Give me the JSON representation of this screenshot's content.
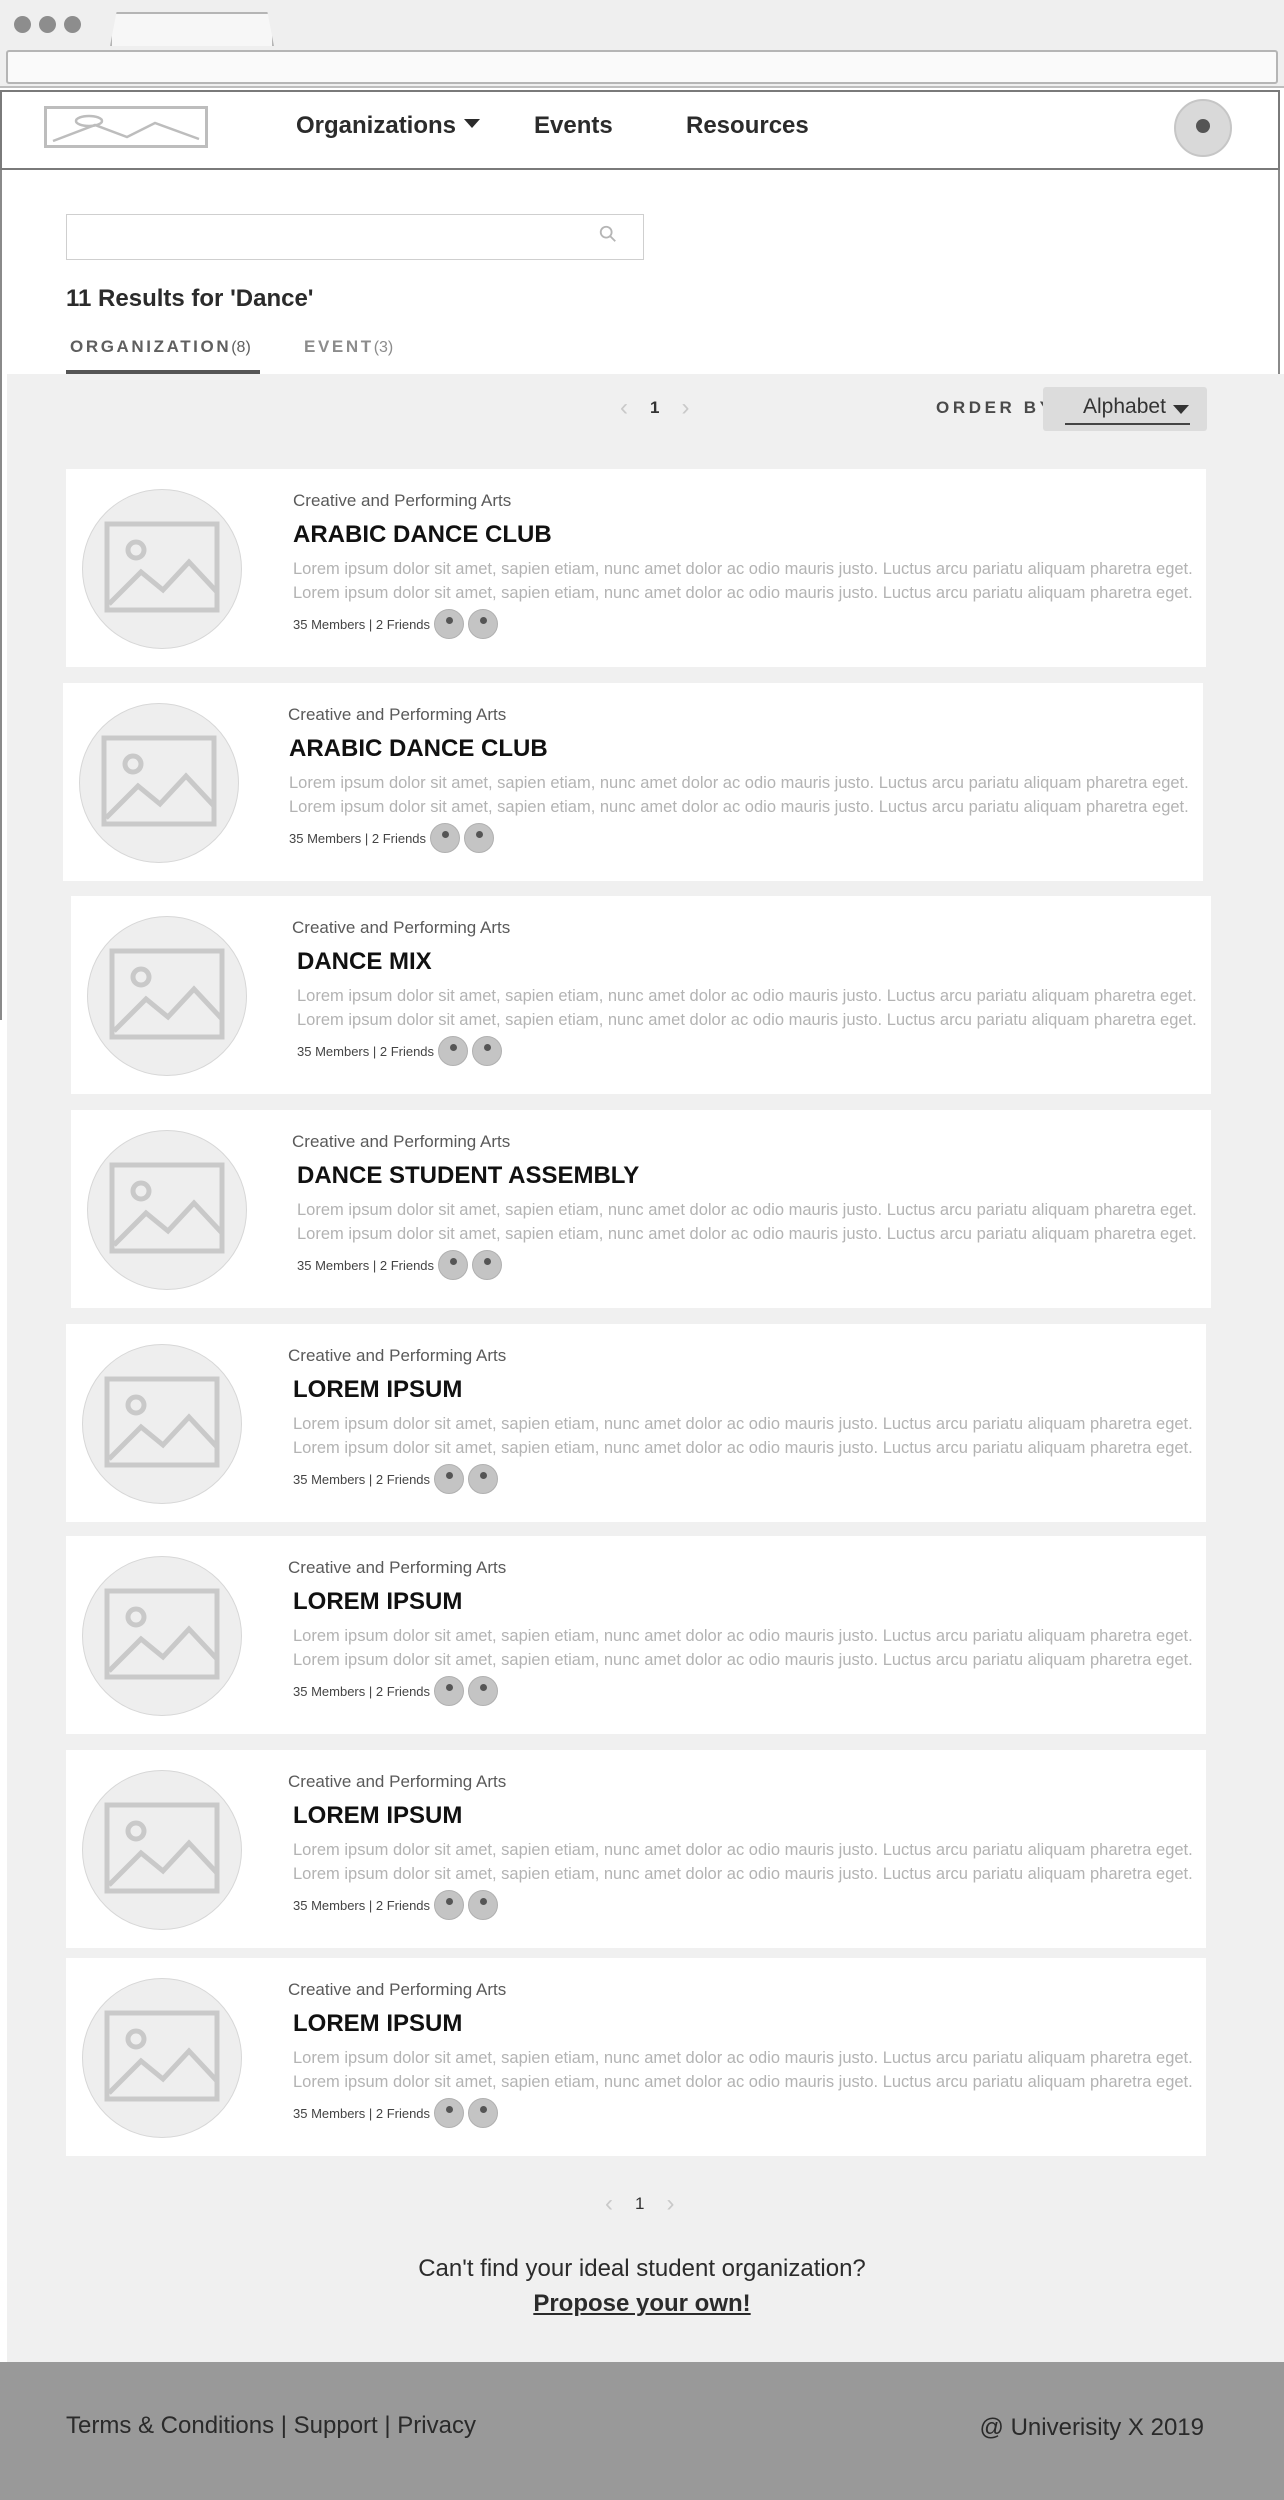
{
  "nav": {
    "organizations": "Organizations",
    "events": "Events",
    "resources": "Resources"
  },
  "search": {
    "value": "",
    "results_title": "11 Results for 'Dance'"
  },
  "tabs": [
    {
      "label": "ORGANIZATION",
      "count": "(8)"
    },
    {
      "label": "EVENT",
      "count": "(3)"
    }
  ],
  "pager": {
    "page": "1",
    "prev": "‹",
    "next": "›"
  },
  "order": {
    "label": "ORDER BY",
    "value": "Alphabet"
  },
  "cards": [
    {
      "category": "Creative and Performing Arts",
      "title": "ARABIC DANCE CLUB",
      "desc1": "Lorem ipsum dolor sit amet, sapien etiam, nunc amet dolor ac odio mauris justo. Luctus arcu pariatu aliquam pharetra eget.",
      "desc2": "Lorem ipsum dolor sit amet, sapien etiam, nunc amet dolor ac odio mauris justo. Luctus arcu pariatu aliquam pharetra eget.",
      "meta": "35 Members | 2 Friends"
    },
    {
      "category": "Creative and Performing Arts",
      "title": "ARABIC DANCE CLUB",
      "desc1": "Lorem ipsum dolor sit amet, sapien etiam, nunc amet dolor ac odio mauris justo. Luctus arcu pariatu aliquam pharetra eget.",
      "desc2": "Lorem ipsum dolor sit amet, sapien etiam, nunc amet dolor ac odio mauris justo. Luctus arcu pariatu aliquam pharetra eget.",
      "meta": "35 Members | 2 Friends"
    },
    {
      "category": "Creative and Performing Arts",
      "title": "DANCE MIX",
      "desc1": "Lorem ipsum dolor sit amet, sapien etiam, nunc amet dolor ac odio mauris justo. Luctus arcu pariatu aliquam pharetra eget.",
      "desc2": "Lorem ipsum dolor sit amet, sapien etiam, nunc amet dolor ac odio mauris justo. Luctus arcu pariatu aliquam pharetra eget.",
      "meta": "35 Members | 2 Friends"
    },
    {
      "category": "Creative and Performing Arts",
      "title": "DANCE STUDENT ASSEMBLY",
      "desc1": "Lorem ipsum dolor sit amet, sapien etiam, nunc amet dolor ac odio mauris justo. Luctus arcu pariatu aliquam pharetra eget.",
      "desc2": "Lorem ipsum dolor sit amet, sapien etiam, nunc amet dolor ac odio mauris justo. Luctus arcu pariatu aliquam pharetra eget.",
      "meta": "35 Members | 2 Friends"
    },
    {
      "category": "Creative and Performing Arts",
      "title": "LOREM IPSUM",
      "desc1": "Lorem ipsum dolor sit amet, sapien etiam, nunc amet dolor ac odio mauris justo. Luctus arcu pariatu aliquam pharetra eget.",
      "desc2": "Lorem ipsum dolor sit amet, sapien etiam, nunc amet dolor ac odio mauris justo. Luctus arcu pariatu aliquam pharetra eget.",
      "meta": "35 Members | 2 Friends"
    },
    {
      "category": "Creative and Performing Arts",
      "title": "LOREM IPSUM",
      "desc1": "Lorem ipsum dolor sit amet, sapien etiam, nunc amet dolor ac odio mauris justo. Luctus arcu pariatu aliquam pharetra eget.",
      "desc2": "Lorem ipsum dolor sit amet, sapien etiam, nunc amet dolor ac odio mauris justo. Luctus arcu pariatu aliquam pharetra eget.",
      "meta": "35 Members | 2 Friends"
    },
    {
      "category": "Creative and Performing Arts",
      "title": "LOREM IPSUM",
      "desc1": "Lorem ipsum dolor sit amet, sapien etiam, nunc amet dolor ac odio mauris justo. Luctus arcu pariatu aliquam pharetra eget.",
      "desc2": "Lorem ipsum dolor sit amet, sapien etiam, nunc amet dolor ac odio mauris justo. Luctus arcu pariatu aliquam pharetra eget.",
      "meta": "35 Members | 2 Friends"
    },
    {
      "category": "Creative and Performing Arts",
      "title": "LOREM IPSUM",
      "desc1": "Lorem ipsum dolor sit amet, sapien etiam, nunc amet dolor ac odio mauris justo. Luctus arcu pariatu aliquam pharetra eget.",
      "desc2": "Lorem ipsum dolor sit amet, sapien etiam, nunc amet dolor ac odio mauris justo. Luctus arcu pariatu aliquam pharetra eget.",
      "meta": "35 Members | 2 Friends"
    }
  ],
  "cta": {
    "question": "Can't find your ideal student organization?",
    "link": "Propose your own!"
  },
  "footer": {
    "terms": "Terms & Conditions",
    "support": "Support",
    "privacy": "Privacy",
    "sep": "|",
    "copyright": "@ Univerisity X 2019"
  },
  "icons": {
    "search": "search-icon",
    "image_placeholder": "image-placeholder-icon",
    "caret": "chevron-down-icon",
    "avatar": "avatar"
  }
}
